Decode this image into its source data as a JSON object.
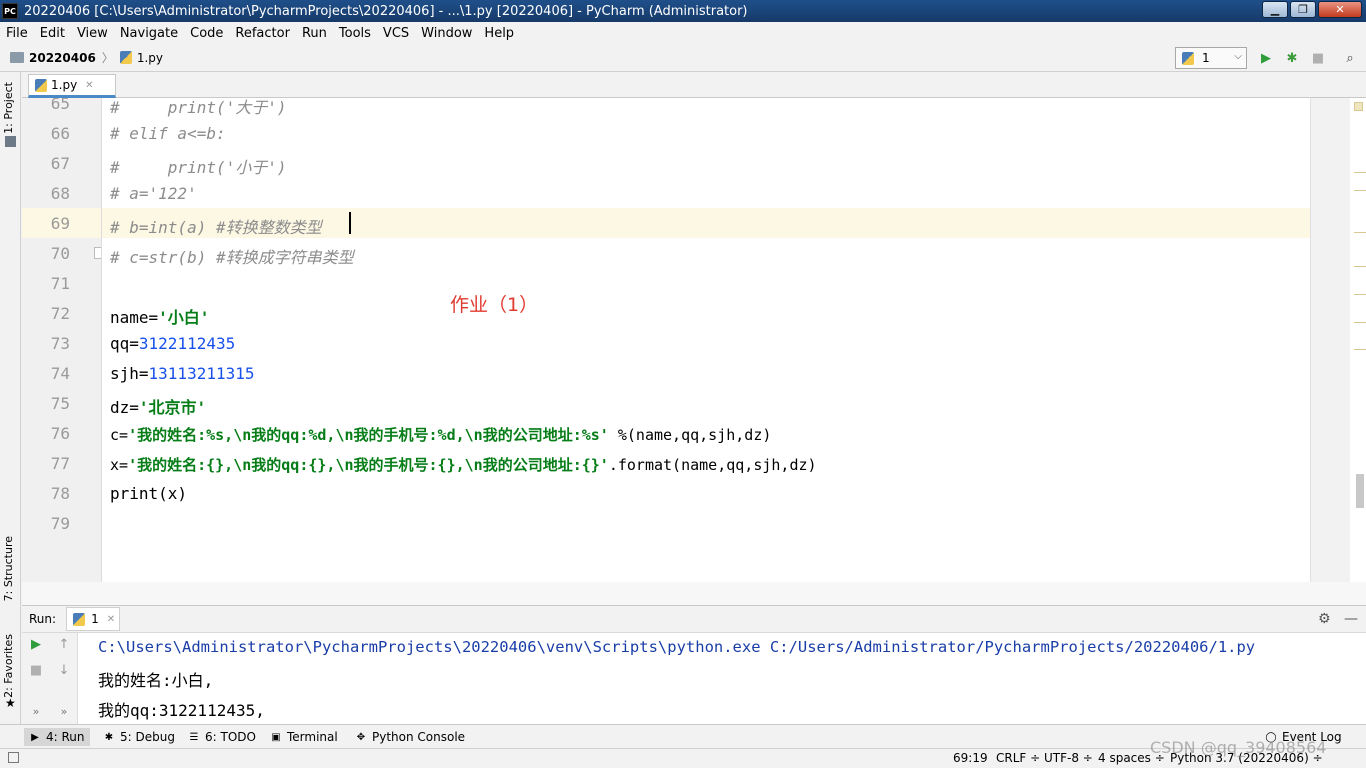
{
  "window": {
    "title": "20220406 [C:\\Users\\Administrator\\PycharmProjects\\20220406] - ...\\1.py [20220406] - PyCharm (Administrator)",
    "app_icon_text": "PC",
    "minimize": "▁",
    "maximize": "❐",
    "close": "✕"
  },
  "menu": [
    "File",
    "Edit",
    "View",
    "Navigate",
    "Code",
    "Refactor",
    "Run",
    "Tools",
    "VCS",
    "Window",
    "Help"
  ],
  "nav": {
    "project": "20220406",
    "file": "1.py"
  },
  "run_config": {
    "label": "1"
  },
  "left_tabs": {
    "project": "1: Project",
    "structure": "7: Structure",
    "favorites": "2: Favorites"
  },
  "editor_tab": {
    "label": "1.py"
  },
  "code_lines": [
    {
      "no": "65",
      "text": "#     print('大于')"
    },
    {
      "no": "66",
      "text": "# elif a<=b:"
    },
    {
      "no": "67",
      "text": "#     print('小于')"
    },
    {
      "no": "68",
      "text": "# a='122'"
    },
    {
      "no": "69",
      "text": "# b=int(a) #转换整数类型"
    },
    {
      "no": "70",
      "text": "# c=str(b) #转换成字符串类型"
    },
    {
      "no": "71",
      "text": ""
    },
    {
      "no": "72",
      "text": "name='小白'"
    },
    {
      "no": "73",
      "text": "qq=3122112435"
    },
    {
      "no": "74",
      "text": "sjh=13113211315"
    },
    {
      "no": "75",
      "text": "dz='北京市'"
    },
    {
      "no": "76",
      "text": "c='我的姓名:%s,\\n我的qq:%d,\\n我的手机号:%d,\\n我的公司地址:%s' %(name,qq,sjh,dz)"
    },
    {
      "no": "77",
      "text": "x='我的姓名:{},\\n我的qq:{},\\n我的手机号:{},\\n我的公司地址:{}'.format(name,qq,sjh,dz)"
    },
    {
      "no": "78",
      "text": "print(x)"
    },
    {
      "no": "79",
      "text": ""
    }
  ],
  "code_tokens": {
    "l72_a": "name=",
    "l72_b": "'小白'",
    "l73_a": "qq=",
    "l73_b": "3122112435",
    "l74_a": "sjh=",
    "l74_b": "13113211315",
    "l75_a": "dz=",
    "l75_b": "'北京市'",
    "l76_a": "c=",
    "l76_b": "'我的姓名:%s,\\n我的qq:%d,\\n我的手机号:%d,\\n我的公司地址:%s'",
    "l76_c": " %(name,qq,sjh,dz)",
    "l77_a": "x=",
    "l77_b": "'我的姓名:{},\\n我的qq:{},\\n我的手机号:{},\\n我的公司地址:{}'",
    "l77_c": ".format(name,qq,sjh,dz)",
    "l78": "print(x)"
  },
  "annotation": "作业（1）",
  "run_panel": {
    "label": "Run:",
    "tab": "1",
    "output": [
      "C:\\Users\\Administrator\\PycharmProjects\\20220406\\venv\\Scripts\\python.exe C:/Users/Administrator/PycharmProjects/20220406/1.py",
      "我的姓名:小白,",
      "我的qq:3122112435,"
    ]
  },
  "bottom_tools": [
    "4: Run",
    "5: Debug",
    "6: TODO",
    "Terminal",
    "Python Console"
  ],
  "event_log": "Event Log",
  "status": {
    "position": "69:19",
    "line_sep": "CRLF ÷",
    "encoding": "UTF-8 ÷",
    "indent": "4 spaces ÷",
    "interpreter": "Python 3.7 (20220406) ÷"
  },
  "watermark": "CSDN @qq_39408564",
  "colors": {
    "title_bar": "#1f4f8a",
    "string": "#067d17",
    "number": "#1750eb",
    "comment": "#8c8c8c",
    "annotation": "#e03a2f"
  }
}
